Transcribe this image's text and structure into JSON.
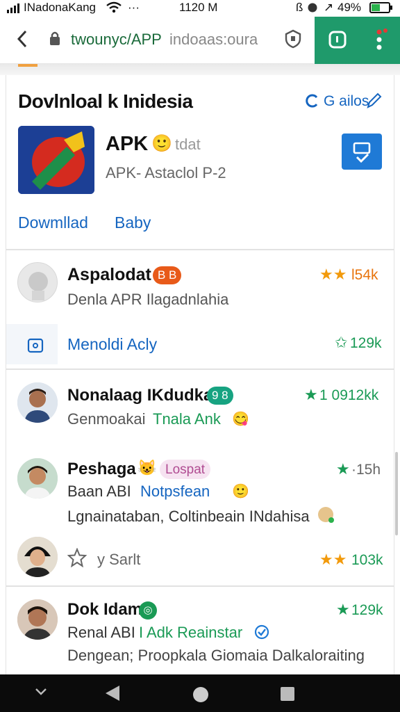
{
  "status": {
    "carrier": "INadonaKang",
    "wifi_icon": "◔",
    "dots": "···",
    "time": "1120 M",
    "bt_icon": "ß",
    "signal_icon": "↗",
    "battery": "49%"
  },
  "browser": {
    "back_icon": "‹",
    "lock_icon": "lock-icon",
    "url_main": "twounyc/APP",
    "url_secondary": "indoaas:oura",
    "shield_icon": "shield-icon",
    "ext_color": "#1f9a6b"
  },
  "header": {
    "title": "Dovlnloal k Inidesia",
    "action_label": "G ailos",
    "app": {
      "name": "APK",
      "emoji": "🙂",
      "tag": "tdat",
      "subtitle": "APK- Astaclol P-2"
    },
    "tabs": [
      "Dowmllad",
      "Baby"
    ]
  },
  "entries": [
    {
      "name": "Aspalodat",
      "badge": "B B",
      "rating": "★★",
      "rating_value": "l54k",
      "desc": "Denla APR Ilagadnlahia",
      "action_label": "Menoldi Acly",
      "action_rating": "✩",
      "action_value": "129k"
    },
    {
      "name": "Nonalaag IKdudka",
      "badge": "9 8",
      "rating": "★",
      "rating_value": "1 0912kk",
      "desc_a": "Genmoakai",
      "desc_b": "Tnala Ank",
      "desc_emoji": "😋"
    },
    {
      "name": "Peshaga",
      "emoji": "😺",
      "badge": "Lospat",
      "rating": "★",
      "rating_value": "·15h",
      "desc_a": "Baan ABI",
      "desc_b": "Notpsfean",
      "desc_emoji": "🙂",
      "extra": "Lgnainataban, Coltinbeain INdahisa",
      "sub_label": "y Sarlt",
      "sub_rating": "★★",
      "sub_value": "103k"
    },
    {
      "name": "Dok Idam",
      "badge": "◎",
      "rating": "★",
      "rating_value": "129k",
      "desc_a": "Renal ABI",
      "desc_b": "I Adk Reainstar",
      "extra": "Dengean; Proopkala Giomaia Dalkaloraiting"
    }
  ],
  "nav": {
    "down_icon": "⌄",
    "back_icon": "◀",
    "home_icon": "●",
    "recent_icon": "■"
  }
}
